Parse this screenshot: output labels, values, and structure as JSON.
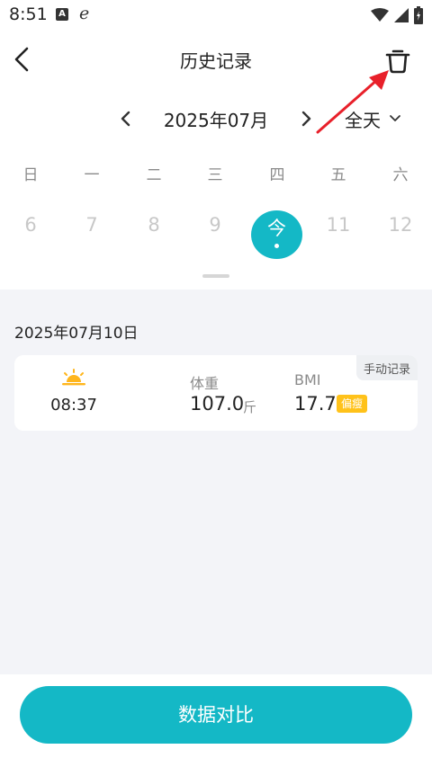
{
  "status_bar": {
    "time": "8:51",
    "notif_a": "A",
    "notif_e": "e"
  },
  "header": {
    "title": "历史记录",
    "back_icon": "back-arrow-icon",
    "delete_icon": "trash-icon"
  },
  "calendar": {
    "month_label": "2025年07月",
    "range_label": "全天",
    "weekdays": [
      "日",
      "一",
      "二",
      "三",
      "四",
      "五",
      "六"
    ],
    "dates": [
      "6",
      "7",
      "8",
      "9",
      "今",
      "11",
      "12"
    ],
    "today_label": "今"
  },
  "records": {
    "date_heading": "2025年07月10日",
    "items": [
      {
        "period_icon": "sunrise-icon",
        "time": "08:37",
        "weight_label": "体重",
        "weight_value": "107.0",
        "weight_unit": "斤",
        "bmi_label": "BMI",
        "bmi_value": "17.7",
        "bmi_status": "偏瘦",
        "source_tag": "手动记录"
      }
    ]
  },
  "footer": {
    "compare_button": "数据对比"
  },
  "colors": {
    "accent": "#14b8c6",
    "annotation_arrow": "#e8202a",
    "bmi_badge": "#ffc21a",
    "sun": "#ffb61d"
  }
}
